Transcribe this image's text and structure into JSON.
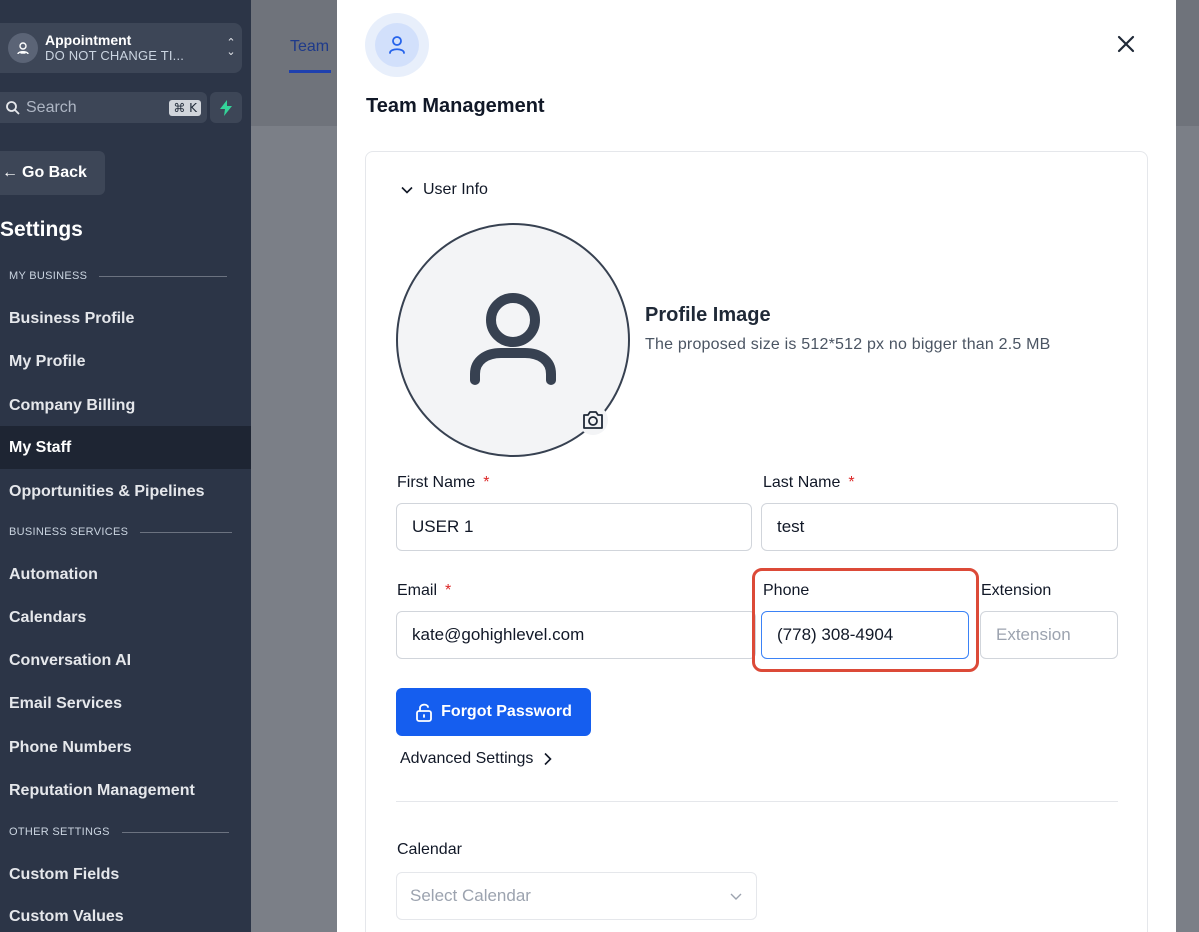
{
  "sidebar": {
    "location": {
      "title": "Appointment",
      "subtitle": "DO NOT CHANGE TI..."
    },
    "search": {
      "placeholder": "Search",
      "shortcut": "⌘ K"
    },
    "go_back": "Go Back",
    "title": "Settings",
    "sections": [
      {
        "label": "MY BUSINESS"
      },
      {
        "label": "BUSINESS SERVICES"
      },
      {
        "label": "OTHER SETTINGS"
      }
    ],
    "items": [
      {
        "label": "Business Profile",
        "active": false
      },
      {
        "label": "My Profile",
        "active": false
      },
      {
        "label": "Company Billing",
        "active": false
      },
      {
        "label": "My Staff",
        "active": true
      },
      {
        "label": "Opportunities & Pipelines",
        "active": false
      },
      {
        "label": "Automation",
        "active": false
      },
      {
        "label": "Calendars",
        "active": false
      },
      {
        "label": "Conversation AI",
        "active": false
      },
      {
        "label": "Email Services",
        "active": false
      },
      {
        "label": "Phone Numbers",
        "active": false
      },
      {
        "label": "Reputation Management",
        "active": false
      },
      {
        "label": "Custom Fields",
        "active": false
      },
      {
        "label": "Custom Values",
        "active": false
      }
    ]
  },
  "main": {
    "tab": "Team"
  },
  "drawer": {
    "title": "Team Management",
    "user_info_label": "User Info",
    "profile_image": {
      "title": "Profile Image",
      "subtitle": "The proposed size is 512*512 px no bigger than 2.5 MB"
    },
    "fields": {
      "first_name": {
        "label": "First Name",
        "required": "*",
        "value": "USER 1"
      },
      "last_name": {
        "label": "Last Name",
        "required": "*",
        "value": "test"
      },
      "email": {
        "label": "Email",
        "required": "*",
        "value": "kate@gohighlevel.com"
      },
      "phone": {
        "label": "Phone",
        "value": "(778) 308-4904"
      },
      "extension": {
        "label": "Extension",
        "placeholder": "Extension"
      }
    },
    "forgot_password": "Forgot Password",
    "advanced_settings": "Advanced Settings",
    "calendar": {
      "label": "Calendar",
      "placeholder": "Select Calendar"
    }
  },
  "colors": {
    "sidebar_bg": "#2c3547",
    "primary_button": "#155eef",
    "highlight": "#dc4a38",
    "required": "#dc2626"
  }
}
